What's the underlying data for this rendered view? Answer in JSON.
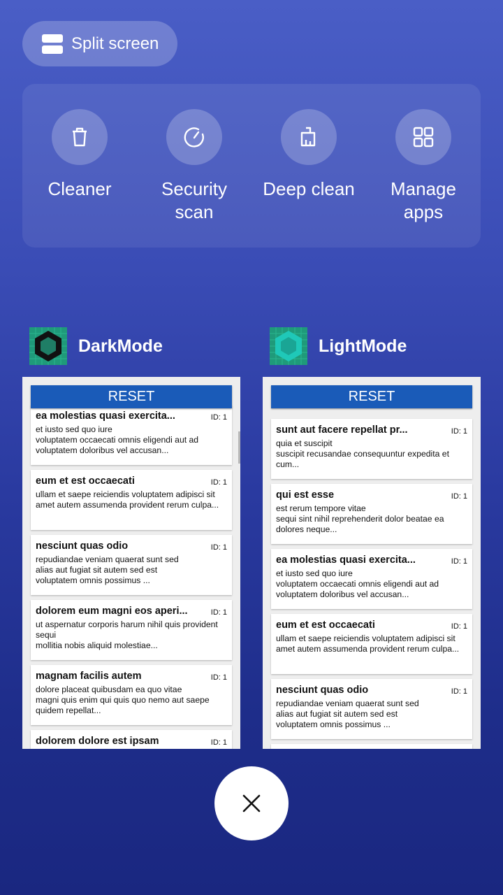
{
  "split_screen": {
    "label": "Split screen",
    "icon": "split-screen-icon"
  },
  "tools": [
    {
      "label": "Cleaner",
      "icon": "trash-icon"
    },
    {
      "label": "Security\nscan",
      "icon": "security-scan-icon"
    },
    {
      "label": "Deep clean",
      "icon": "broom-icon"
    },
    {
      "label": "Manage\napps",
      "icon": "grid-icon"
    }
  ],
  "apps": [
    {
      "name": "DarkMode",
      "reset_label": "RESET",
      "items": [
        {
          "title": "ea molestias quasi exercita...",
          "id": "ID: 1",
          "body": "et iusto sed quo iure\nvoluptatem occaecati omnis eligendi aut ad voluptatem doloribus vel accusan..."
        },
        {
          "title": "eum et est occaecati",
          "id": "ID: 1",
          "body": "ullam et saepe reiciendis voluptatem adipisci sit amet autem assumenda provident rerum culpa..."
        },
        {
          "title": "nesciunt quas odio",
          "id": "ID: 1",
          "body": "repudiandae veniam quaerat sunt sed\nalias aut fugiat sit autem sed est\nvoluptatem omnis possimus ..."
        },
        {
          "title": "dolorem eum magni eos aperi...",
          "id": "ID: 1",
          "body": "ut aspernatur corporis harum nihil quis provident sequi\nmollitia nobis aliquid molestiae..."
        },
        {
          "title": "magnam facilis autem",
          "id": "ID: 1",
          "body": "dolore placeat quibusdam ea quo vitae\nmagni quis enim qui quis quo nemo aut saepe quidem repellat..."
        },
        {
          "title": "dolorem dolore est ipsam",
          "id": "ID: 1",
          "body": ""
        }
      ]
    },
    {
      "name": "LightMode",
      "reset_label": "RESET",
      "items": [
        {
          "title": "sunt aut facere repellat pr...",
          "id": "ID: 1",
          "body": "quia et suscipit\nsuscipit recusandae consequuntur expedita et cum..."
        },
        {
          "title": "qui est esse",
          "id": "ID: 1",
          "body": "est rerum tempore vitae\nsequi sint nihil reprehenderit dolor beatae ea dolores neque..."
        },
        {
          "title": "ea molestias quasi exercita...",
          "id": "ID: 1",
          "body": "et iusto sed quo iure\nvoluptatem occaecati omnis eligendi aut ad voluptatem doloribus vel accusan..."
        },
        {
          "title": "eum et est occaecati",
          "id": "ID: 1",
          "body": "ullam et saepe reiciendis voluptatem adipisci sit amet autem assumenda provident rerum culpa..."
        },
        {
          "title": "nesciunt quas odio",
          "id": "ID: 1",
          "body": "repudiandae veniam quaerat sunt sed\nalias aut fugiat sit autem sed est\nvoluptatem omnis possimus ..."
        },
        {
          "title": "",
          "id": "",
          "body": ""
        }
      ]
    }
  ],
  "close": {
    "icon": "close-icon"
  }
}
